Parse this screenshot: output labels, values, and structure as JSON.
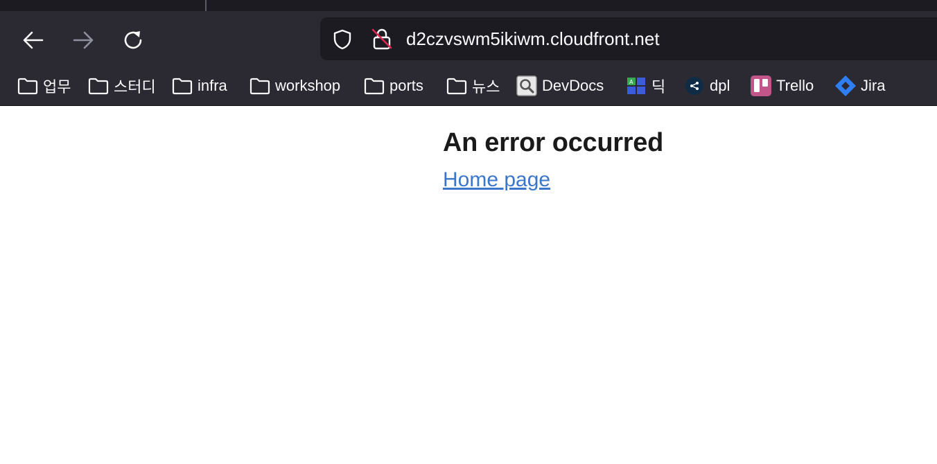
{
  "browser": {
    "url": "d2czvswm5ikiwm.cloudfront.net"
  },
  "bookmarks": [
    {
      "label": "업무",
      "icon": "folder-icon"
    },
    {
      "label": "스터디",
      "icon": "folder-icon"
    },
    {
      "label": "infra",
      "icon": "folder-icon"
    },
    {
      "label": "workshop",
      "icon": "folder-icon"
    },
    {
      "label": "ports",
      "icon": "folder-icon"
    },
    {
      "label": "뉴스",
      "icon": "folder-icon"
    },
    {
      "label": "DevDocs",
      "icon": "devdocs-icon"
    },
    {
      "label": "딕",
      "icon": "dict-icon"
    },
    {
      "label": "dpl",
      "icon": "dpl-icon"
    },
    {
      "label": "Trello",
      "icon": "trello-icon"
    },
    {
      "label": "Jira",
      "icon": "jira-icon"
    }
  ],
  "page": {
    "title": "An error occurred",
    "link": "Home page"
  },
  "colors": {
    "chrome_dark": "#1c1b22",
    "chrome": "#2b2a33",
    "link": "#3a77c9",
    "trello": "#c2568b",
    "jira": "#2f7ff4"
  }
}
